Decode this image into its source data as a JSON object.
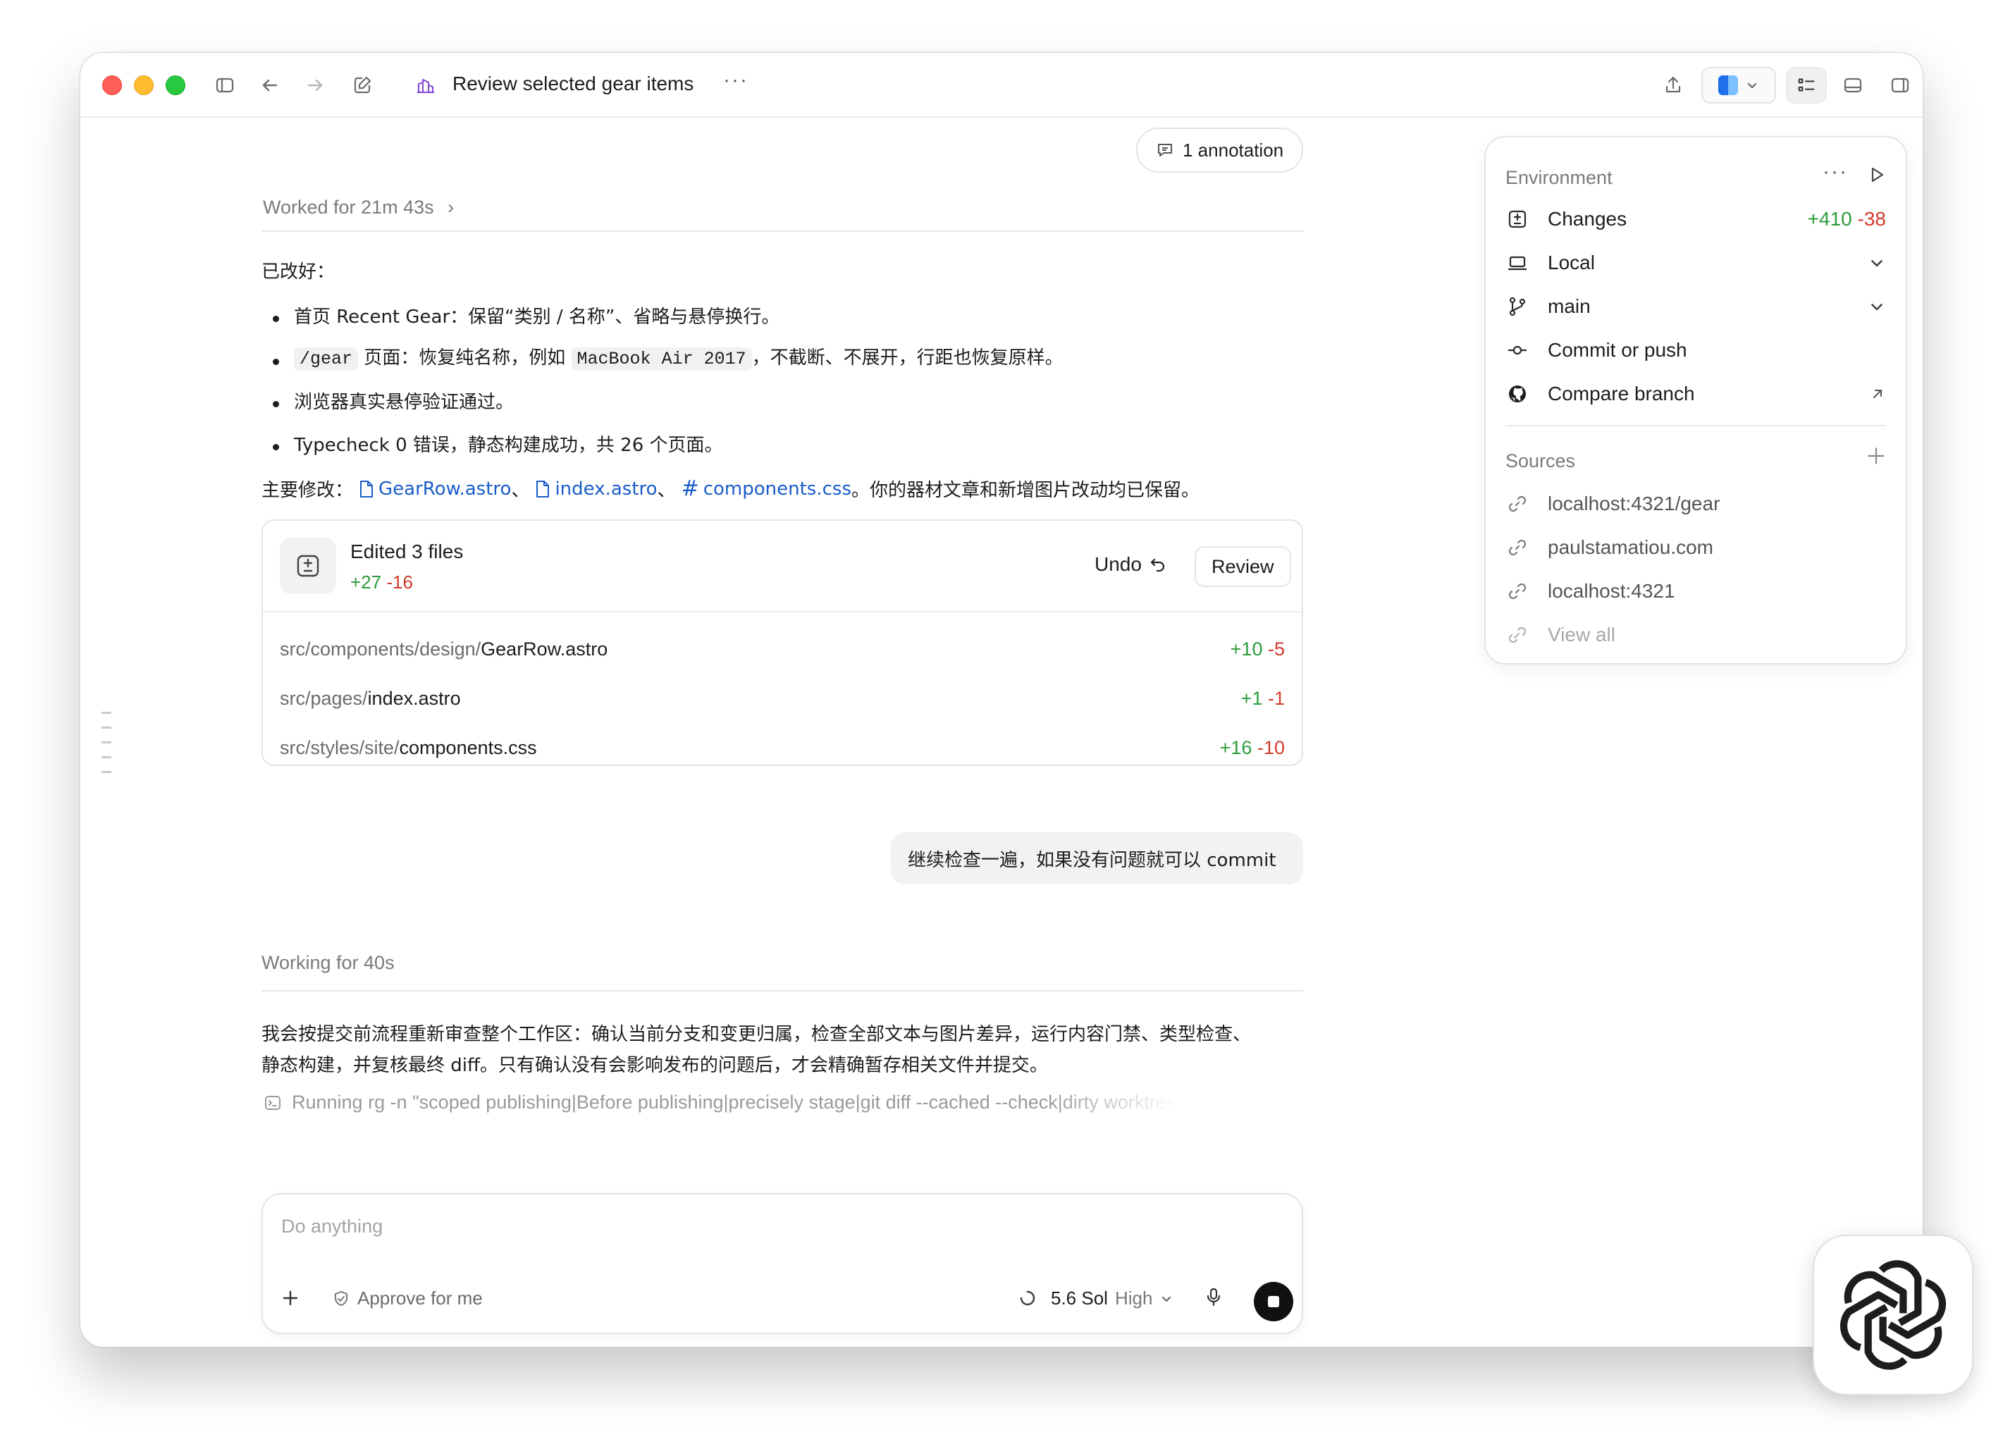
{
  "titlebar": {
    "title": "Review selected gear items",
    "more": "···"
  },
  "annotation_label": "1 annotation",
  "worked_label": "Worked for 21m 43s",
  "summary": {
    "intro": "已改好：",
    "b1": "首页 Recent Gear：保留“类别 / 名称”、省略与悬停换行。",
    "b2_code1": "/gear",
    "b2_mid": " 页面：恢复纯名称，例如 ",
    "b2_code2": "MacBook Air 2017",
    "b2_end": "，不截断、不展开，行距也恢复原样。",
    "b3": "浏览器真实悬停验证通过。",
    "b4": "Typecheck 0 错误，静态构建成功，共 26 个页面。",
    "changes_prefix": "主要修改：",
    "file1": "GearRow.astro",
    "sep1": "、",
    "file2": "index.astro",
    "sep2": "、",
    "file3": "components.css",
    "changes_suffix": "。你的器材文章和新增图片改动均已保留。"
  },
  "edited_card": {
    "title": "Edited 3 files",
    "add": "+27",
    "del": "-16",
    "undo": "Undo",
    "review": "Review",
    "files": [
      {
        "dir": "src/components/design/",
        "name": "GearRow.astro",
        "add": "+10",
        "del": "-5"
      },
      {
        "dir": "src/pages/",
        "name": "index.astro",
        "add": "+1",
        "del": "-1"
      },
      {
        "dir": "src/styles/site/",
        "name": "components.css",
        "add": "+16",
        "del": "-10"
      }
    ]
  },
  "user_message": "继续检查一遍，如果没有问题就可以 commit",
  "working_label": "Working for 40s",
  "working_text_1": "我会按提交前流程重新审查整个工作区：确认当前分支和变更归属，检查全部文本与图片差异，运行内容门禁、类型检查、",
  "working_text_2": "静态构建，并复核最终 diff。只有确认没有会影响发布的问题后，才会精确暂存相关文件并提交。",
  "running_text": "Running rg -n \"scoped publishing|Before publishing|precisely stage|git diff --cached --check|dirty worktree",
  "composer": {
    "placeholder": "Do anything",
    "approve": "Approve for me",
    "model": "5.6 Sol",
    "effort": "High"
  },
  "environment": {
    "heading": "Environment",
    "rows": {
      "changes": {
        "label": "Changes",
        "add": "+410",
        "del": "-38"
      },
      "local": {
        "label": "Local"
      },
      "branch": {
        "label": "main"
      },
      "commit": {
        "label": "Commit or push"
      },
      "compare": {
        "label": "Compare branch"
      }
    },
    "sources_heading": "Sources",
    "sources": [
      "localhost:4321/gear",
      "paulstamatiou.com",
      "localhost:4321"
    ],
    "view_all": "View all"
  },
  "colors": {
    "add": "#2a9d3b",
    "del": "#d23a2c",
    "link": "#1a5dc8",
    "accent": "#1f6feb"
  }
}
